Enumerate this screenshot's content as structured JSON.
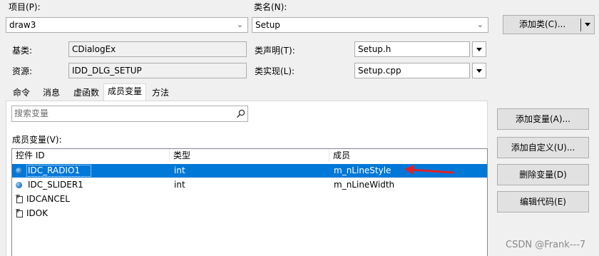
{
  "project": {
    "label": "项目(P):",
    "value": "draw3"
  },
  "classname": {
    "label": "类名(N):",
    "value": "Setup"
  },
  "add_class_button": "添加类(C)...",
  "base_class": {
    "label": "基类:",
    "value": "CDialogEx"
  },
  "class_declaration": {
    "label": "类声明(T):",
    "value": "Setup.h"
  },
  "resource": {
    "label": "资源:",
    "value": "IDD_DLG_SETUP"
  },
  "class_implementation": {
    "label": "类实现(L):",
    "value": "Setup.cpp"
  },
  "tabs": [
    {
      "label": "命令"
    },
    {
      "label": "消息"
    },
    {
      "label": "虚函数"
    },
    {
      "label": "成员变量",
      "active": true
    },
    {
      "label": "方法"
    }
  ],
  "search": {
    "placeholder": "搜索变量"
  },
  "member_list": {
    "label": "成员变量(V):",
    "columns": [
      "控件 ID",
      "类型",
      "成员"
    ],
    "rows": [
      {
        "id": "IDC_RADIO1",
        "type": "int",
        "member": "m_nLineStyle",
        "icon": "variable-icon",
        "selected": true
      },
      {
        "id": "IDC_SLIDER1",
        "type": "int",
        "member": "m_nLineWidth",
        "icon": "variable-icon",
        "selected": false
      },
      {
        "id": "IDCANCEL",
        "type": "",
        "member": "",
        "icon": "control-icon",
        "selected": false
      },
      {
        "id": "IDOK",
        "type": "",
        "member": "",
        "icon": "control-icon",
        "selected": false
      }
    ]
  },
  "buttons": {
    "add_variable": "添加变量(A)...",
    "add_custom": "添加自定义(U)...",
    "delete_variable": "删除变量(D)",
    "edit_code": "编辑代码(E)"
  },
  "watermark": "CSDN @Frank---7",
  "colors": {
    "selection": "#0078d7",
    "annotation_arrow": "#e0202a"
  }
}
